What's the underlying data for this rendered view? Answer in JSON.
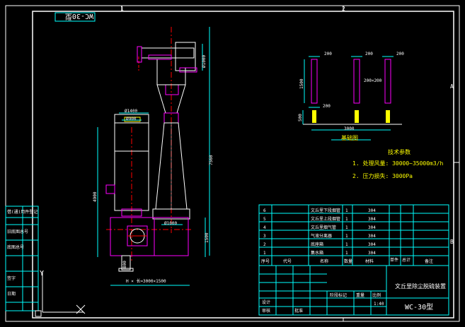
{
  "drawing": {
    "stamp_rotated": "WC-30型",
    "zone_top_1": "1",
    "zone_top_2": "2",
    "zone_right_a": "A",
    "zone_right_b": "B"
  },
  "dimensions": {
    "top_pipe": "Ø1000",
    "tower_top_dia": "Ø1400",
    "tower_inner_dia": "Ø900",
    "tower_height": "4900",
    "total_height": "7560",
    "cone_base": "Ø1000",
    "base_height": "1500",
    "outlet": "800",
    "base_size": "H × 长=3000×1500"
  },
  "foundation": {
    "dim_200_a": "200",
    "dim_200_b": "200",
    "dim_200_c": "200",
    "dim_200_d": "200",
    "dim_200x200": "200×200",
    "height_1500": "1500",
    "height_500": "500",
    "width_3000": "3000",
    "caption": "基础图"
  },
  "tech": {
    "title": "技术参数",
    "item1": "1. 处理风量: 30000~35000m3/h",
    "item2": "2. 压力损失: 3000Pa"
  },
  "bom": {
    "rows": [
      {
        "no": "6",
        "name": "文丘里下段烟管",
        "qty": "1",
        "mat": "304"
      },
      {
        "no": "5",
        "name": "文丘里上段烟管",
        "qty": "1",
        "mat": "304"
      },
      {
        "no": "4",
        "name": "文丘里烟气管",
        "qty": "1",
        "mat": "304"
      },
      {
        "no": "3",
        "name": "气液分离器",
        "qty": "1",
        "mat": "304"
      },
      {
        "no": "2",
        "name": "底座箱",
        "qty": "1",
        "mat": "304"
      },
      {
        "no": "1",
        "name": "集水箱",
        "qty": "1",
        "mat": "304"
      }
    ],
    "header": {
      "no": "序号",
      "code": "代号",
      "name": "名称",
      "qty": "数量",
      "mat": "材料",
      "wt1": "单件",
      "wt2": "总计",
      "note": "备注"
    }
  },
  "title_block": {
    "project": "文丘里除尘脱硫装置",
    "model": "WC-30型",
    "scale": "1:40",
    "label_design": "设计",
    "label_check": "审核",
    "label_approve": "批准",
    "label_stage": "阶段标记",
    "label_weight": "重量",
    "label_ratio": "比例"
  },
  "side_labels": {
    "l1": "借(通)用件登记",
    "l2": "旧底图总号",
    "l3": "底图总号",
    "l4": "签字",
    "l5": "日期"
  },
  "ucs": {
    "label": "Y"
  }
}
